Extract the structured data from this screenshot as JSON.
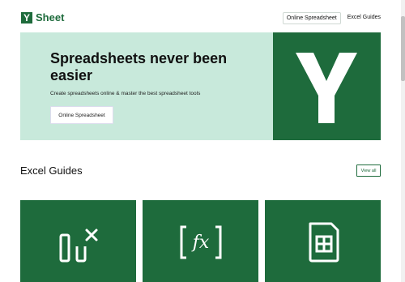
{
  "header": {
    "logo_letter": "Y",
    "logo_text": "Sheet",
    "nav": [
      {
        "label": "Online Spreadsheet"
      },
      {
        "label": "Excel Guides"
      }
    ]
  },
  "hero": {
    "title": "Spreadsheets never been easier",
    "subtitle": "Create spreadsheets online & master the best spreadsheet tools",
    "button_label": "Online Spreadsheet",
    "logo_letter": "Y"
  },
  "guides": {
    "title": "Excel Guides",
    "view_all_label": "View all",
    "cards": [
      {
        "icon": "clear-columns-icon"
      },
      {
        "icon": "function-fx-icon"
      },
      {
        "icon": "sim-card-grid-icon"
      }
    ]
  },
  "colors": {
    "brand": "#1e6b3c",
    "hero_bg": "#c8e9db"
  }
}
